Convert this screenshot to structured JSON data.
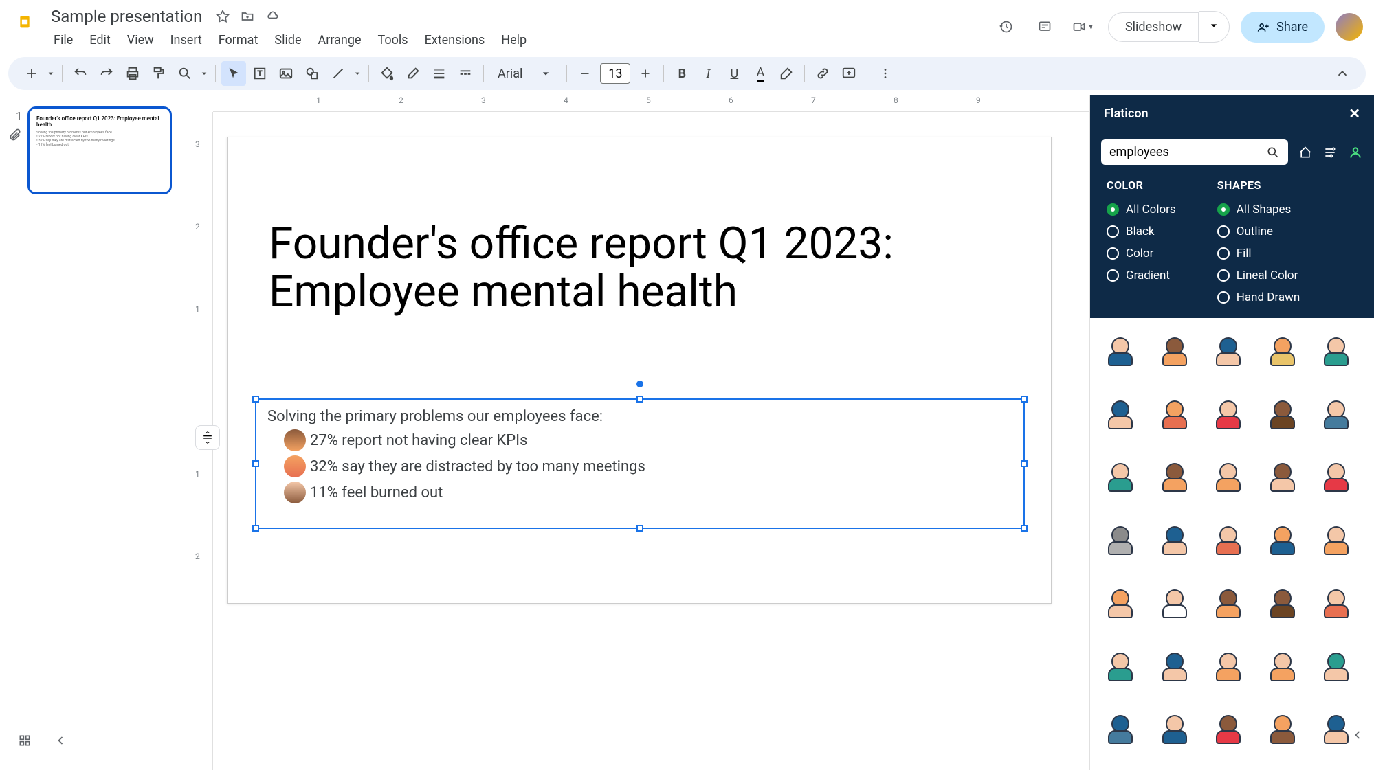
{
  "document": {
    "title": "Sample presentation"
  },
  "menu": {
    "file": "File",
    "edit": "Edit",
    "view": "View",
    "insert": "Insert",
    "format": "Format",
    "slide": "Slide",
    "arrange": "Arrange",
    "tools": "Tools",
    "extensions": "Extensions",
    "help": "Help"
  },
  "header_actions": {
    "slideshow": "Slideshow",
    "share": "Share"
  },
  "toolbar": {
    "font_name": "Arial",
    "font_size": "13"
  },
  "slide_panel": {
    "slide_number": "1",
    "thumb_title": "Founder's office report Q1 2023: Employee mental health"
  },
  "slide": {
    "title": "Founder's office report Q1 2023: Employee mental health",
    "subtitle": "Solving the primary problems our employees face:",
    "bullets": [
      "27% report not having clear KPIs",
      "32% say they are distracted by too many meetings",
      "11% feel burned out"
    ]
  },
  "flaticon": {
    "panel_title": "Flaticon",
    "search_value": "employees",
    "filters": {
      "color_title": "COLOR",
      "shapes_title": "SHAPES",
      "color_options": [
        "All Colors",
        "Black",
        "Color",
        "Gradient"
      ],
      "shape_options": [
        "All Shapes",
        "Outline",
        "Fill",
        "Lineal Color",
        "Hand Drawn"
      ],
      "color_selected": "All Colors",
      "shape_selected": "All Shapes"
    },
    "icon_colors": [
      [
        "#f4c7a8",
        "#1e6091"
      ],
      [
        "#8b5a3c",
        "#f4a261"
      ],
      [
        "#1e6091",
        "#f4c7a8"
      ],
      [
        "#f4a261",
        "#e9c46a"
      ],
      [
        "#f4c7a8",
        "#2a9d8f"
      ],
      [
        "#1e6091",
        "#f4c7a8"
      ],
      [
        "#f4a261",
        "#e76f51"
      ],
      [
        "#f4c7a8",
        "#e63946"
      ],
      [
        "#8b5a3c",
        "#6b4423"
      ],
      [
        "#f4c7a8",
        "#457b9d"
      ],
      [
        "#f4c7a8",
        "#2a9d8f"
      ],
      [
        "#8b5a3c",
        "#f4a261"
      ],
      [
        "#f4c7a8",
        "#f4a261"
      ],
      [
        "#8b5a3c",
        "#f4c7a8"
      ],
      [
        "#f4c7a8",
        "#e63946"
      ],
      [
        "#8b8b8b",
        "#b0b0b0"
      ],
      [
        "#1e6091",
        "#f4c7a8"
      ],
      [
        "#f4c7a8",
        "#e76f51"
      ],
      [
        "#f4a261",
        "#1e6091"
      ],
      [
        "#f4c7a8",
        "#f4a261"
      ],
      [
        "#f4a261",
        "#f4c7a8"
      ],
      [
        "#f4c7a8",
        "#ffffff"
      ],
      [
        "#8b5a3c",
        "#f4a261"
      ],
      [
        "#8b5a3c",
        "#6b4423"
      ],
      [
        "#f4c7a8",
        "#e76f51"
      ],
      [
        "#f4c7a8",
        "#2a9d8f"
      ],
      [
        "#1e6091",
        "#f4c7a8"
      ],
      [
        "#f4c7a8",
        "#f4a261"
      ],
      [
        "#f4c7a8",
        "#f4a261"
      ],
      [
        "#2a9d8f",
        "#f4c7a8"
      ],
      [
        "#1e6091",
        "#457b9d"
      ],
      [
        "#f4c7a8",
        "#1e6091"
      ],
      [
        "#8b5a3c",
        "#e63946"
      ],
      [
        "#f4a261",
        "#8b5a3c"
      ],
      [
        "#1e6091",
        "#f4c7a8"
      ]
    ]
  },
  "ruler": {
    "h_marks": [
      "1",
      "2",
      "3",
      "4",
      "5",
      "6",
      "7",
      "8",
      "9"
    ],
    "v_marks": [
      "3",
      "2",
      "1",
      "1",
      "2"
    ]
  }
}
